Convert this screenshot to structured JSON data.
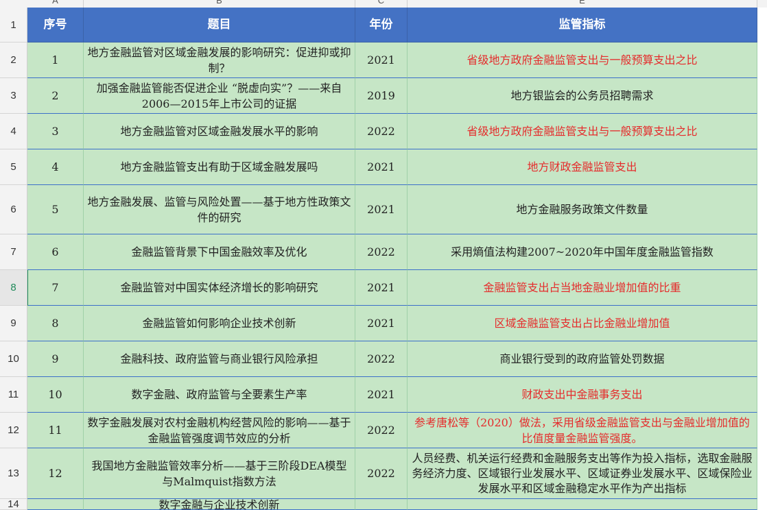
{
  "column_letters": [
    "A",
    "B",
    "C",
    "E"
  ],
  "row_numbers": [
    "1",
    "2",
    "3",
    "4",
    "5",
    "6",
    "7",
    "8",
    "9",
    "10",
    "11",
    "12",
    "13",
    "14"
  ],
  "header": [
    "序号",
    "题目",
    "年份",
    "监管指标"
  ],
  "rows": [
    {
      "num": "1",
      "title": "地方金融监管对区域金融发展的影响研究：促进抑或抑制？",
      "year": "2021",
      "indicator": "省级地方政府金融监管支出与一般预算支出之比",
      "red": true
    },
    {
      "num": "2",
      "title": "加强金融监管能否促进企业 “脱虚向实”？——来自2006—2015年上市公司的证据",
      "year": "2019",
      "indicator": "地方银监会的公务员招聘需求",
      "red": false
    },
    {
      "num": "3",
      "title": "地方金融监管对区域金融发展水平的影响",
      "year": "2022",
      "indicator": "省级地方政府金融监管支出与一般预算支出之比",
      "red": true
    },
    {
      "num": "4",
      "title": "地方金融监管支出有助于区域金融发展吗",
      "year": "2021",
      "indicator": "地方财政金融监管支出",
      "red": true
    },
    {
      "num": "5",
      "title": "地方金融发展、监管与风险处置——基于地方性政策文件的研究",
      "year": "2021",
      "indicator": "地方金融服务政策文件数量",
      "red": false
    },
    {
      "num": "6",
      "title": "金融监管背景下中国金融效率及优化",
      "year": "2022",
      "indicator": "采用熵值法构建2007~2020年中国年度金融监管指数",
      "red": false
    },
    {
      "num": "7",
      "title": "金融监管对中国实体经济增长的影响研究",
      "year": "2021",
      "indicator": "金融监管支出占当地金融业增加值的比重",
      "red": true
    },
    {
      "num": "8",
      "title": "金融监管如何影响企业技术创新",
      "year": "2021",
      "indicator": "区域金融监管支出占比金融业增加值",
      "red": true
    },
    {
      "num": "9",
      "title": "金融科技、政府监管与商业银行风险承担",
      "year": "2022",
      "indicator": "商业银行受到的政府监管处罚数据",
      "red": false
    },
    {
      "num": "10",
      "title": "数字金融、政府监管与全要素生产率",
      "year": "2021",
      "indicator": "财政支出中金融事务支出",
      "red": true
    },
    {
      "num": "11",
      "title": "数字金融发展对农村金融机构经营风险的影响——基于金融监管强度调节效应的分析",
      "year": "2022",
      "indicator": "参考唐松等（2020）做法，采用省级金融监管支出与金融业增加值的比值度量金融监管强度。",
      "red": true
    },
    {
      "num": "12",
      "title": "我国地方金融监管效率分析——基于三阶段DEA模型与Malmquist指数方法",
      "year": "2022",
      "indicator": "人员经费、机关运行经费和金融服务支出等作为投入指标，选取金融服务经济力度、区域银行业发展水平、区域证券业发展水平、区域保险业发展水平和区域金融稳定水平作为产出指标",
      "red": false
    },
    {
      "num": "",
      "title": "数字金融与企业技术创新",
      "year": "",
      "indicator": "",
      "red": false
    }
  ]
}
